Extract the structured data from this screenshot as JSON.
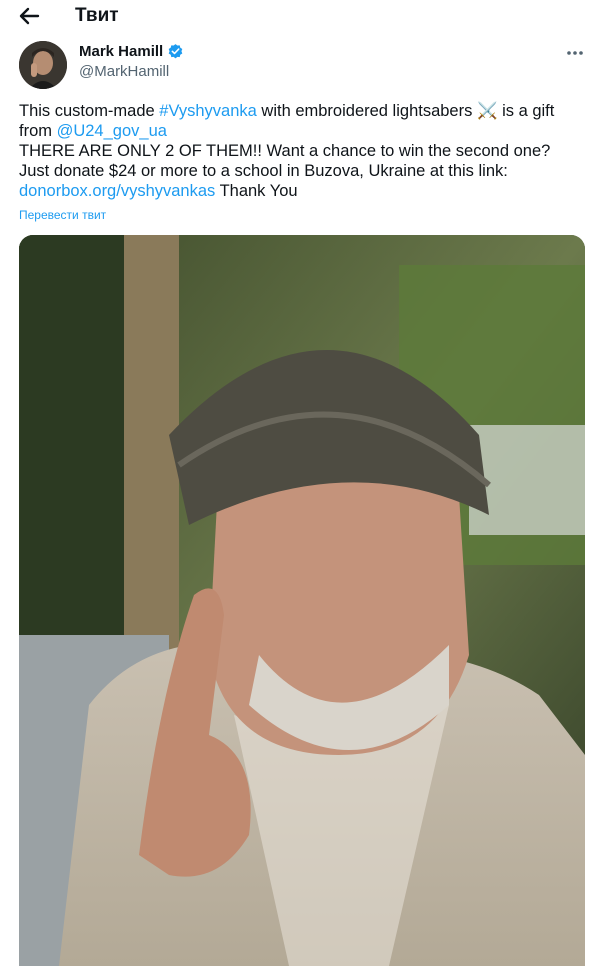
{
  "header": {
    "title": "Твит",
    "back_icon": "arrow-left-icon"
  },
  "author": {
    "name": "Mark Hamill",
    "handle": "@MarkHamill",
    "verified_icon": "verified-badge-icon",
    "verified_color": "#1d9bf0"
  },
  "more_icon": "more-horizontal-icon",
  "tweet": {
    "text_1": "This custom-made ",
    "hashtag": "#Vyshyvanka",
    "text_2": " with embroidered lightsabers ",
    "emoji": "⚔️",
    "text_3": " is a gift from ",
    "mention": "@U24_gov_ua",
    "text_4": "THERE ARE ONLY 2 OF THEM!! Want a chance to win the second one? Just donate $24 or more to a school in Buzova, Ukraine at this link: ",
    "link": "donorbox.org/vyshyvankas",
    "text_5": " Thank You"
  },
  "translate_label": "Перевести твит",
  "colors": {
    "link": "#1d9bf0",
    "text": "#0f1419",
    "secondary": "#536471"
  }
}
